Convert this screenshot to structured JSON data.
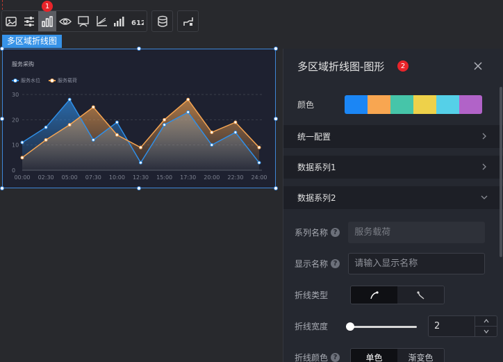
{
  "toolbar": {
    "badge": "1",
    "items": [
      "image-icon",
      "sliders-icon",
      "bar-chart-icon",
      "eye-icon",
      "monitor-icon",
      "axis-icon",
      "signal-bars-icon",
      "digits-icon"
    ],
    "digits_text": "612",
    "extra": [
      "database-icon",
      "link-icon"
    ]
  },
  "component_tag": "多区域折线图",
  "chart_data": {
    "type": "area",
    "title": "服务采购",
    "legend_position": "top-left",
    "grid": true,
    "x": [
      "00:00",
      "02:30",
      "05:00",
      "07:30",
      "10:00",
      "12:30",
      "15:00",
      "17:30",
      "20:00",
      "22:30",
      "24:00"
    ],
    "x_full": [
      0,
      1,
      2,
      2.8,
      3.4,
      4,
      4.5,
      5,
      5.6,
      6.2,
      6.8,
      7.5,
      8,
      8.6,
      9.2,
      10
    ],
    "ylim": [
      0,
      30
    ],
    "yticks": [
      "0",
      "10",
      "20",
      "30"
    ],
    "series": [
      {
        "name": "服务水位",
        "color": "#2f8fe8",
        "values": [
          11,
          17,
          28,
          12,
          19,
          3,
          18,
          23,
          10,
          15,
          3
        ]
      },
      {
        "name": "服务载荷",
        "color": "#f5a451",
        "values": [
          5,
          12,
          18,
          25,
          14,
          9,
          20,
          28,
          15,
          19,
          9
        ]
      }
    ]
  },
  "panel": {
    "title": "多区域折线图-图形",
    "badge": "2",
    "color_label": "颜色",
    "palette": [
      "#1b86f5",
      "#f8a651",
      "#46c5a9",
      "#eed14a",
      "#55d0e8",
      "#b163c8"
    ],
    "sections": [
      "统一配置",
      "数据系列1",
      "数据系列2"
    ],
    "fields": {
      "series_name_label": "系列名称",
      "series_name_value": "服务载荷",
      "display_name_label": "显示名称",
      "display_name_placeholder": "请输入显示名称",
      "line_type_label": "折线类型",
      "line_width_label": "折线宽度",
      "line_width_value": "2",
      "line_width_level": 0.0,
      "line_color_label": "折线颜色",
      "line_color_options": [
        "单色",
        "渐变色"
      ]
    }
  }
}
